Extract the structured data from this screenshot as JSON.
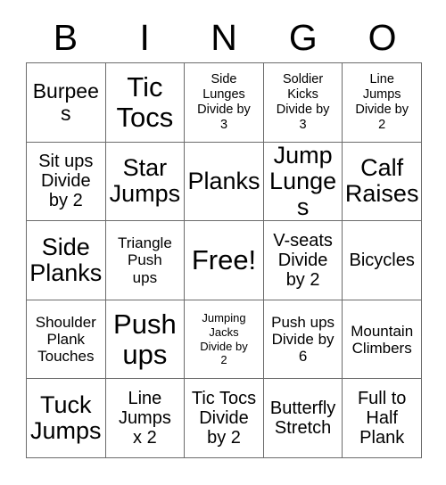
{
  "card": {
    "title": "BINGO",
    "header_letters": [
      "B",
      "I",
      "N",
      "G",
      "O"
    ],
    "free_space_label": "Free!",
    "grid_line_color": "#6b6b6b",
    "text_color": "#000000",
    "background_color": "#ffffff",
    "columns": 5,
    "rows": 5,
    "cells": [
      {
        "text": "Burpees",
        "size": "lg"
      },
      {
        "text": "Tic\nTocs",
        "size": "xxl"
      },
      {
        "text": "Side\nLunges\nDivide by\n3",
        "size": "xs"
      },
      {
        "text": "Soldier\nKicks\nDivide by\n3",
        "size": "xs"
      },
      {
        "text": "Line\nJumps\nDivide by\n2",
        "size": "xs"
      },
      {
        "text": "Sit ups\nDivide\nby 2",
        "size": "md"
      },
      {
        "text": "Star\nJumps",
        "size": "xl"
      },
      {
        "text": "Planks",
        "size": "xl"
      },
      {
        "text": "Jump\nLunges",
        "size": "xl"
      },
      {
        "text": "Calf\nRaises",
        "size": "xl"
      },
      {
        "text": "Side\nPlanks",
        "size": "xl"
      },
      {
        "text": "Triangle\nPush\nups",
        "size": "sm"
      },
      {
        "text": "Free!",
        "size": "xxl"
      },
      {
        "text": "V-seats\nDivide\nby 2",
        "size": "md"
      },
      {
        "text": "Bicycles",
        "size": "md"
      },
      {
        "text": "Shoulder\nPlank\nTouches",
        "size": "sm"
      },
      {
        "text": "Push\nups",
        "size": "xxl"
      },
      {
        "text": "Jumping\nJacks\nDivide by\n2",
        "size": "xxs"
      },
      {
        "text": "Push ups\nDivide by\n6",
        "size": "sm"
      },
      {
        "text": "Mountain\nClimbers",
        "size": "sm"
      },
      {
        "text": "Tuck\nJumps",
        "size": "xl"
      },
      {
        "text": "Line\nJumps\nx 2",
        "size": "md"
      },
      {
        "text": "Tic Tocs\nDivide\nby 2",
        "size": "md"
      },
      {
        "text": "Butterfly\nStretch",
        "size": "md"
      },
      {
        "text": "Full to\nHalf\nPlank",
        "size": "md"
      }
    ]
  }
}
